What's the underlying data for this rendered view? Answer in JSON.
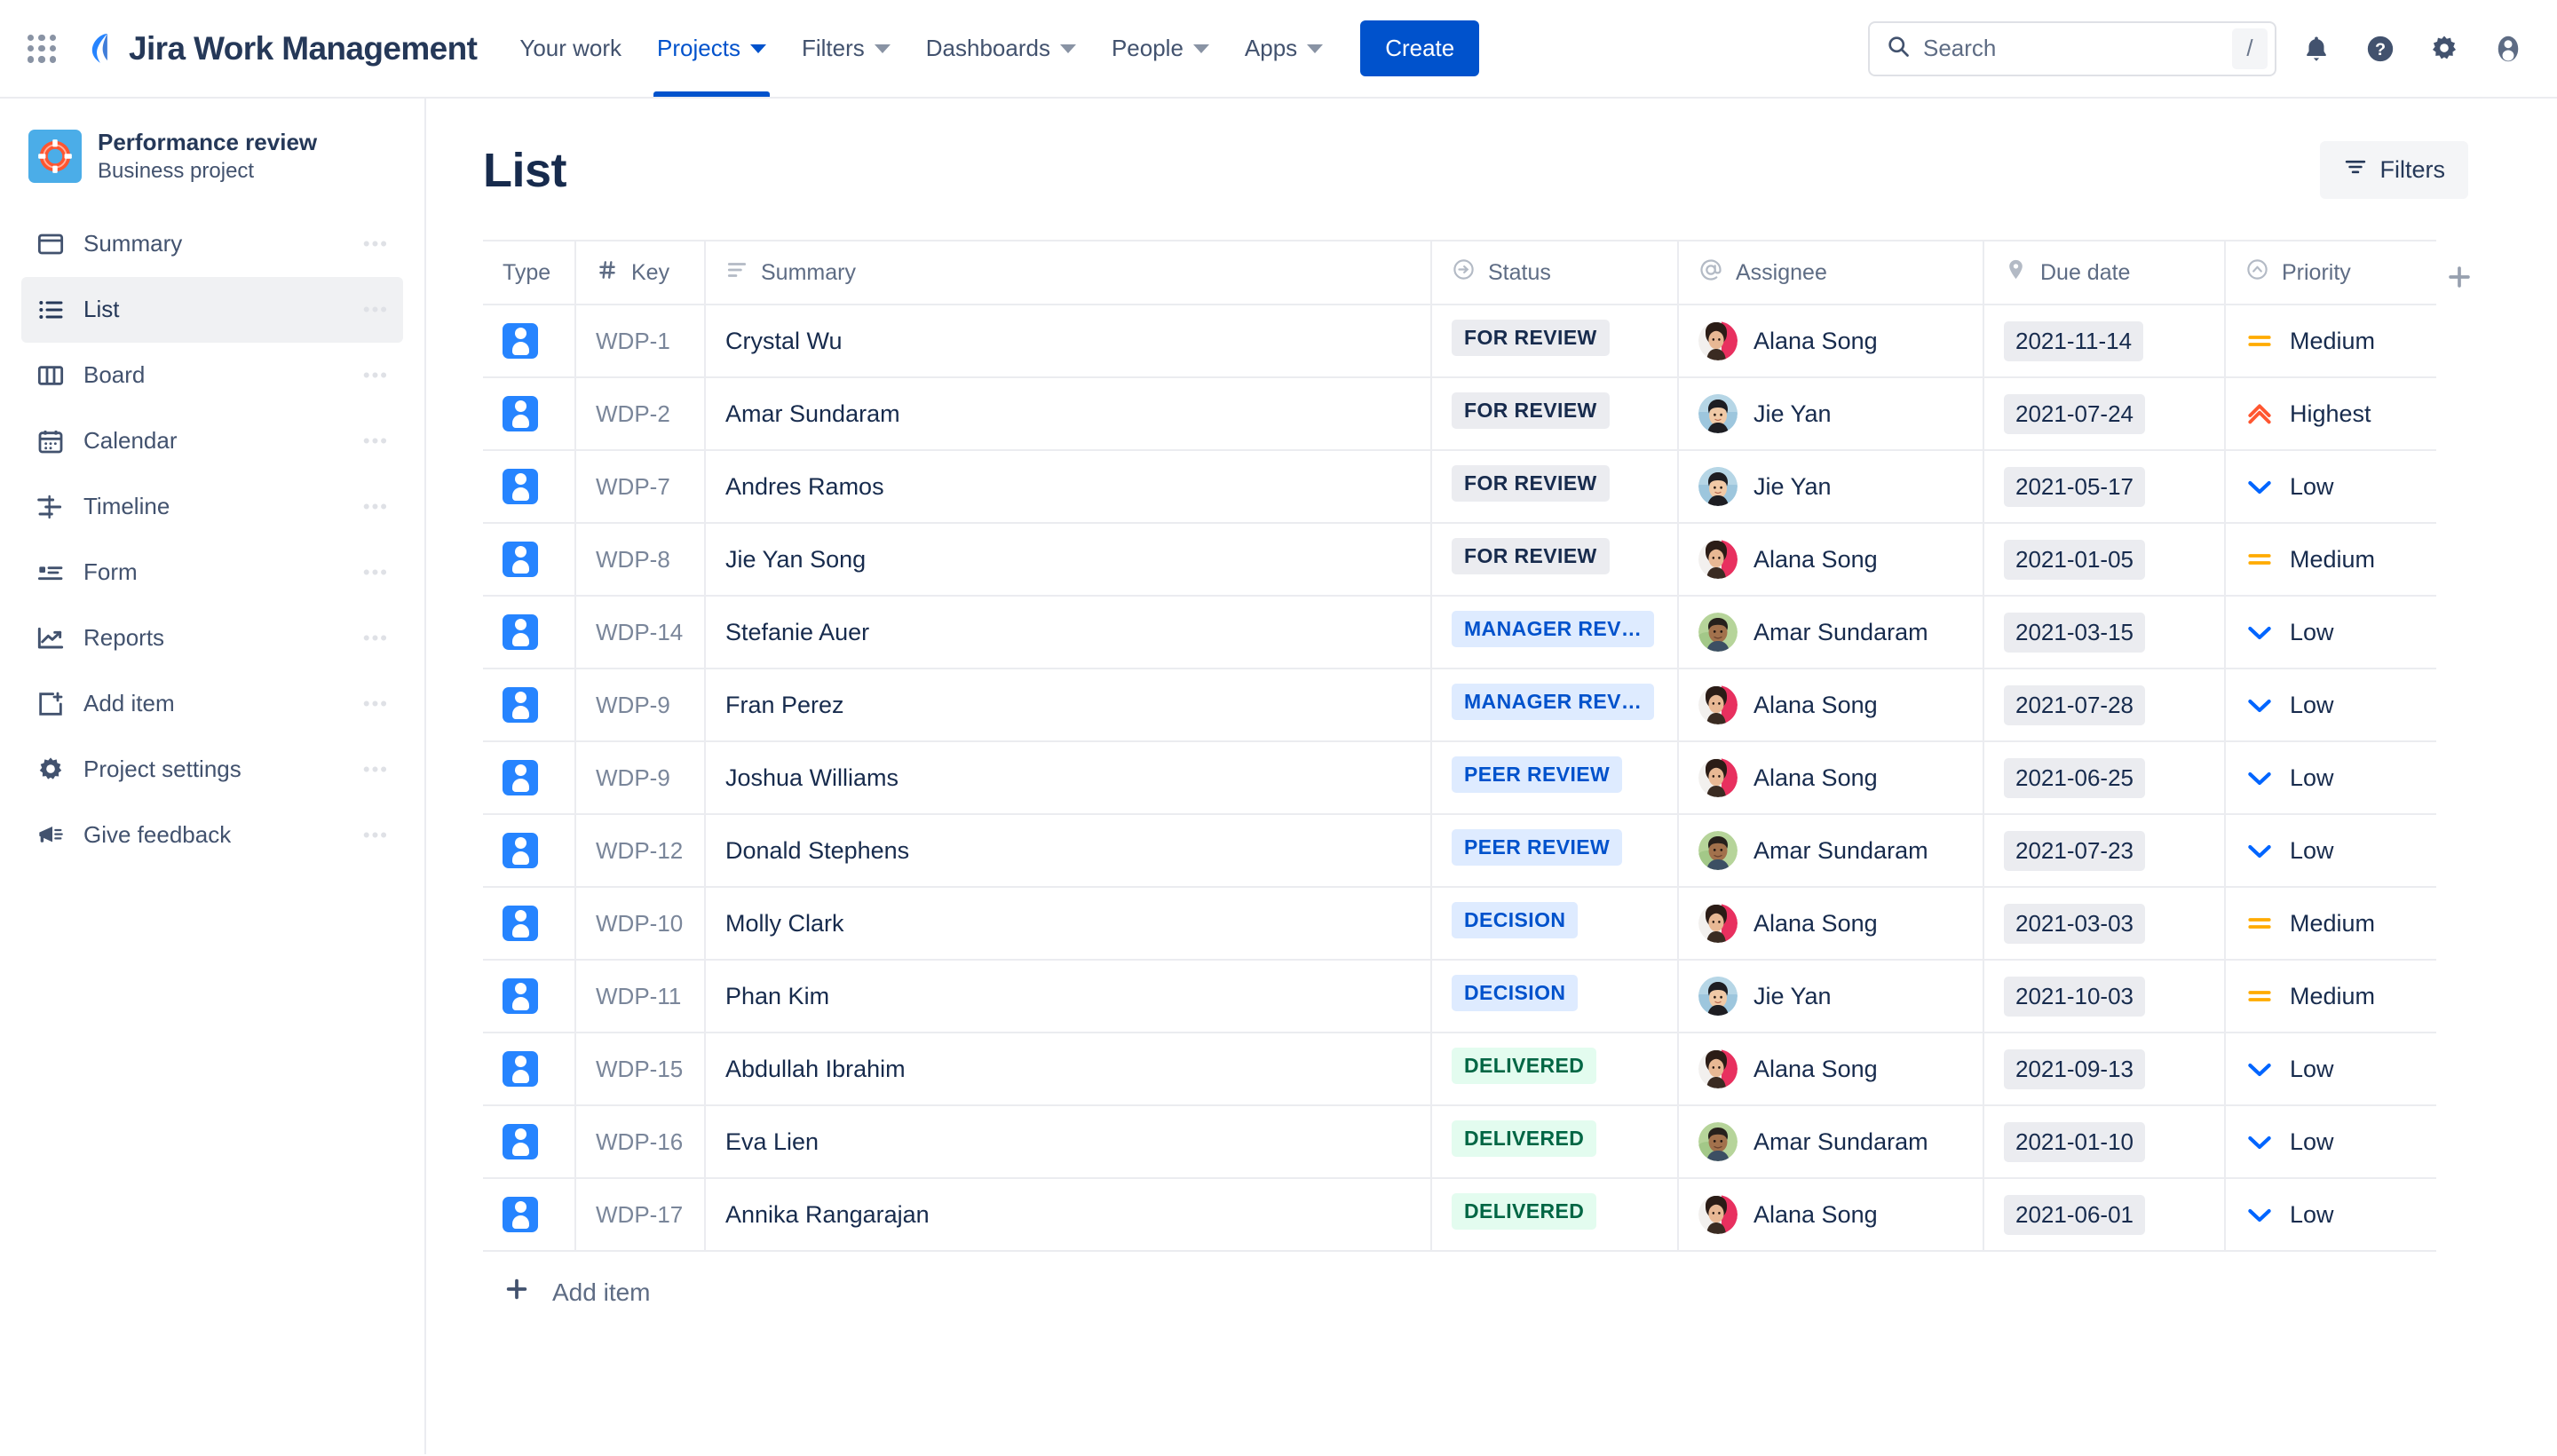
{
  "topnav": {
    "apps_label": "app-switcher",
    "brand": "Jira Work Management",
    "items": [
      {
        "label": "Your work",
        "has_caret": false,
        "active": false
      },
      {
        "label": "Projects",
        "has_caret": true,
        "active": true
      },
      {
        "label": "Filters",
        "has_caret": true,
        "active": false
      },
      {
        "label": "Dashboards",
        "has_caret": true,
        "active": false
      },
      {
        "label": "People",
        "has_caret": true,
        "active": false
      },
      {
        "label": "Apps",
        "has_caret": true,
        "active": false
      }
    ],
    "create_label": "Create",
    "search": {
      "placeholder": "Search",
      "value": "",
      "shortcut": "/"
    },
    "right_icons": [
      "notifications-bell-icon",
      "help-icon",
      "settings-gear-icon",
      "account-avatar-icon"
    ]
  },
  "sidebar": {
    "project": {
      "name": "Performance review",
      "type": "Business project",
      "icon": "lifebuoy-icon"
    },
    "items": [
      {
        "label": "Summary",
        "icon": "summary-icon",
        "active": false
      },
      {
        "label": "List",
        "icon": "list-icon",
        "active": true
      },
      {
        "label": "Board",
        "icon": "board-icon",
        "active": false
      },
      {
        "label": "Calendar",
        "icon": "calendar-icon",
        "active": false
      },
      {
        "label": "Timeline",
        "icon": "timeline-icon",
        "active": false
      },
      {
        "label": "Form",
        "icon": "form-icon",
        "active": false
      },
      {
        "label": "Reports",
        "icon": "reports-icon",
        "active": false
      },
      {
        "label": "Add item",
        "icon": "add-item-icon",
        "active": false
      },
      {
        "label": "Project settings",
        "icon": "gear-icon",
        "active": false
      },
      {
        "label": "Give feedback",
        "icon": "megaphone-icon",
        "active": false
      }
    ]
  },
  "main": {
    "title": "List",
    "filters_button": "Filters",
    "add_item_label": "Add item",
    "add_column_label": "+"
  },
  "table": {
    "columns": [
      {
        "label": "Type",
        "icon": null,
        "key": "type"
      },
      {
        "label": "Key",
        "icon": "hash-icon",
        "key": "key"
      },
      {
        "label": "Summary",
        "icon": "lines-icon",
        "key": "summary"
      },
      {
        "label": "Status",
        "icon": "arrow-circle-icon",
        "key": "status"
      },
      {
        "label": "Assignee",
        "icon": "at-icon",
        "key": "assignee"
      },
      {
        "label": "Due date",
        "icon": "tag-icon",
        "key": "due"
      },
      {
        "label": "Priority",
        "icon": "chevron-circle-icon",
        "key": "priority"
      }
    ],
    "rows": [
      {
        "type_icon": "task-icon",
        "key": "WDP-1",
        "summary": "Crystal Wu",
        "status": "FOR REVIEW",
        "status_class": "st-todo",
        "assignee": "Alana Song",
        "avatar": "alana",
        "due": "2021-11-14",
        "priority": "Medium",
        "priority_icon": "medium-icon"
      },
      {
        "type_icon": "task-icon",
        "key": "WDP-2",
        "summary": "Amar Sundaram",
        "status": "FOR REVIEW",
        "status_class": "st-todo",
        "assignee": "Jie Yan",
        "avatar": "jie",
        "due": "2021-07-24",
        "priority": "Highest",
        "priority_icon": "highest-icon"
      },
      {
        "type_icon": "task-icon",
        "key": "WDP-7",
        "summary": "Andres Ramos",
        "status": "FOR REVIEW",
        "status_class": "st-todo",
        "assignee": "Jie Yan",
        "avatar": "jie",
        "due": "2021-05-17",
        "priority": "Low",
        "priority_icon": "low-icon"
      },
      {
        "type_icon": "task-icon",
        "key": "WDP-8",
        "summary": "Jie Yan Song",
        "status": "FOR REVIEW",
        "status_class": "st-todo",
        "assignee": "Alana Song",
        "avatar": "alana",
        "due": "2021-01-05",
        "priority": "Medium",
        "priority_icon": "medium-icon"
      },
      {
        "type_icon": "task-icon",
        "key": "WDP-14",
        "summary": "Stefanie Auer",
        "status": "MANAGER REV…",
        "status_class": "st-prog",
        "assignee": "Amar Sundaram",
        "avatar": "amar",
        "due": "2021-03-15",
        "priority": "Low",
        "priority_icon": "low-icon"
      },
      {
        "type_icon": "task-icon",
        "key": "WDP-9",
        "summary": "Fran Perez",
        "status": "MANAGER REV…",
        "status_class": "st-prog",
        "assignee": "Alana Song",
        "avatar": "alana",
        "due": "2021-07-28",
        "priority": "Low",
        "priority_icon": "low-icon"
      },
      {
        "type_icon": "task-icon",
        "key": "WDP-9",
        "summary": "Joshua Williams",
        "status": "PEER REVIEW",
        "status_class": "st-prog",
        "assignee": "Alana Song",
        "avatar": "alana",
        "due": "2021-06-25",
        "priority": "Low",
        "priority_icon": "low-icon"
      },
      {
        "type_icon": "task-icon",
        "key": "WDP-12",
        "summary": "Donald Stephens",
        "status": "PEER REVIEW",
        "status_class": "st-prog",
        "assignee": "Amar Sundaram",
        "avatar": "amar",
        "due": "2021-07-23",
        "priority": "Low",
        "priority_icon": "low-icon"
      },
      {
        "type_icon": "task-icon",
        "key": "WDP-10",
        "summary": "Molly Clark",
        "status": "DECISION",
        "status_class": "st-prog",
        "assignee": "Alana Song",
        "avatar": "alana",
        "due": "2021-03-03",
        "priority": "Medium",
        "priority_icon": "medium-icon"
      },
      {
        "type_icon": "task-icon",
        "key": "WDP-11",
        "summary": "Phan Kim",
        "status": "DECISION",
        "status_class": "st-prog",
        "assignee": "Jie Yan",
        "avatar": "jie",
        "due": "2021-10-03",
        "priority": "Medium",
        "priority_icon": "medium-icon"
      },
      {
        "type_icon": "task-icon",
        "key": "WDP-15",
        "summary": "Abdullah Ibrahim",
        "status": "DELIVERED",
        "status_class": "st-done",
        "assignee": "Alana Song",
        "avatar": "alana",
        "due": "2021-09-13",
        "priority": "Low",
        "priority_icon": "low-icon"
      },
      {
        "type_icon": "task-icon",
        "key": "WDP-16",
        "summary": "Eva Lien",
        "status": "DELIVERED",
        "status_class": "st-done",
        "assignee": "Amar Sundaram",
        "avatar": "amar",
        "due": "2021-01-10",
        "priority": "Low",
        "priority_icon": "low-icon"
      },
      {
        "type_icon": "task-icon",
        "key": "WDP-17",
        "summary": "Annika Rangarajan",
        "status": "DELIVERED",
        "status_class": "st-done",
        "assignee": "Alana Song",
        "avatar": "alana",
        "due": "2021-06-01",
        "priority": "Low",
        "priority_icon": "low-icon"
      }
    ]
  },
  "colors": {
    "brand_blue": "#0052cc",
    "accent_blue": "#2684ff",
    "status_todo_bg": "#ebecf0",
    "status_progress_bg": "#deebff",
    "status_done_bg": "#e3fcef",
    "status_done_text": "#006644",
    "priority_medium": "#ffab00",
    "priority_highest": "#ff5630",
    "priority_low": "#0065ff",
    "text_primary": "#172b4d",
    "text_subtle": "#5e6c84"
  }
}
